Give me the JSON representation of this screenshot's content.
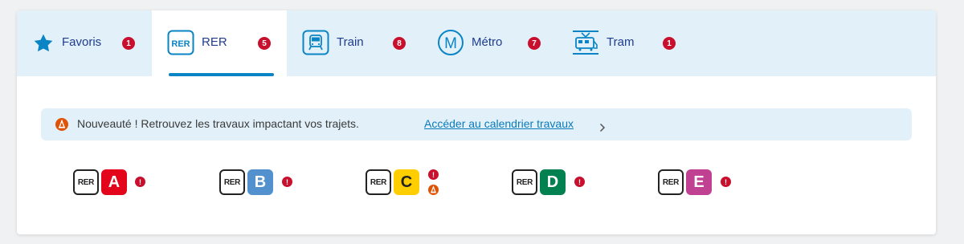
{
  "tabs": [
    {
      "label": "Favoris",
      "count": "1",
      "icon": "star-icon"
    },
    {
      "label": "RER",
      "count": "5",
      "icon": "rer-icon",
      "icon_text": "RER",
      "active": true
    },
    {
      "label": "Train",
      "count": "8",
      "icon": "train-icon"
    },
    {
      "label": "Métro",
      "count": "7",
      "icon": "metro-icon",
      "icon_text": "M"
    },
    {
      "label": "Tram",
      "count": "1",
      "icon": "tram-icon"
    }
  ],
  "banner": {
    "text": "Nouveauté ! Retrouvez les travaux impactant vos trajets.",
    "link": "Accéder au calendrier travaux",
    "icon": "roadworks-icon"
  },
  "lines": [
    {
      "badge": "RER",
      "letter": "A",
      "color": "#e3051b",
      "text_color": "#ffffff",
      "alert": "!"
    },
    {
      "badge": "RER",
      "letter": "B",
      "color": "#5291ce",
      "text_color": "#ffffff",
      "alert": "!"
    },
    {
      "badge": "RER",
      "letter": "C",
      "color": "#ffce00",
      "text_color": "#222222",
      "alert": "!",
      "works": true
    },
    {
      "badge": "RER",
      "letter": "D",
      "color": "#00814f",
      "text_color": "#ffffff",
      "alert": "!"
    },
    {
      "badge": "RER",
      "letter": "E",
      "color": "#c04191",
      "text_color": "#ffffff",
      "alert": "!"
    }
  ],
  "colors": {
    "tab_bg": "#e2f1f9",
    "accent": "#0a84c4",
    "alert": "#c8102e",
    "works": "#e05206",
    "label": "#1f3c8f"
  }
}
